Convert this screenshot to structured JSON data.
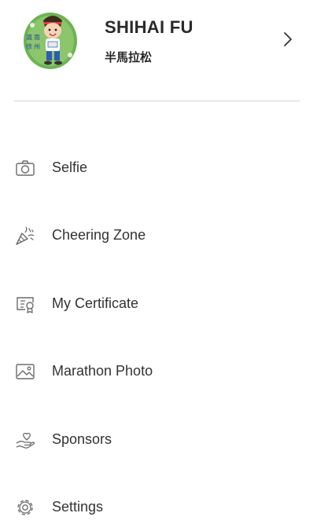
{
  "profile": {
    "name": "SHIHAI FU",
    "subtitle": "半馬拉松",
    "avatar_icon": "runner-mascot-avatar",
    "chevron_icon": "chevron-right-icon"
  },
  "menu": {
    "items": [
      {
        "label": "Selfie",
        "icon": "camera-icon"
      },
      {
        "label": "Cheering Zone",
        "icon": "party-popper-icon"
      },
      {
        "label": "My Certificate",
        "icon": "certificate-icon"
      },
      {
        "label": "Marathon Photo",
        "icon": "image-icon"
      },
      {
        "label": "Sponsors",
        "icon": "handshake-icon"
      },
      {
        "label": "Settings",
        "icon": "gear-icon"
      }
    ]
  },
  "colors": {
    "text": "#2b2b2b",
    "icon_stroke": "#6b6b6b",
    "divider": "#d4d4d4",
    "avatar_green": "#5fa84a"
  }
}
